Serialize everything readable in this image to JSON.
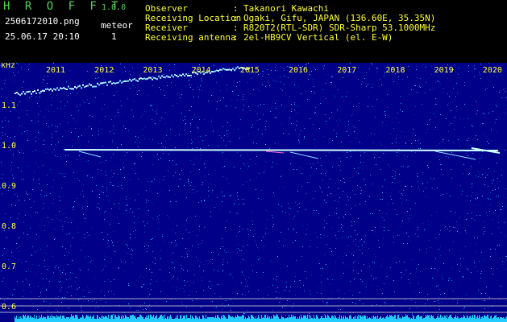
{
  "header": {
    "app_title": "H R O F F T",
    "version": "1.0.0",
    "image_file": "2506172010.png",
    "timestamp": "25.06.17 20:10",
    "meteor_label": "meteor",
    "meteor_count": "1",
    "info": [
      {
        "label": "Observer",
        "value": "Takanori Kawachi"
      },
      {
        "label": "Receiving Location",
        "value": "Ogaki, Gifu, JAPAN (136.60E, 35.35N)"
      },
      {
        "label": "Receiver",
        "value": "R820T2(RTL-SDR) SDR-Sharp 53.1000MHz"
      },
      {
        "label": "Receiving antenna",
        "value": "2el-HB9CV Vertical (el. E-W)"
      }
    ]
  },
  "spectrogram": {
    "y_unit": "kHz",
    "y_ticks": [
      "1.1",
      "1.0",
      "0.9",
      "0.8",
      "0.7",
      "0.6"
    ],
    "x_ticks": [
      "2011",
      "2012",
      "2013",
      "2014",
      "2015",
      "2016",
      "2017",
      "2018",
      "2019",
      "2020"
    ],
    "colors": {
      "background": "#000088",
      "noise_bright": "#22aaff",
      "trace": "#ccffff",
      "axis_text": "#ffff33"
    }
  }
}
